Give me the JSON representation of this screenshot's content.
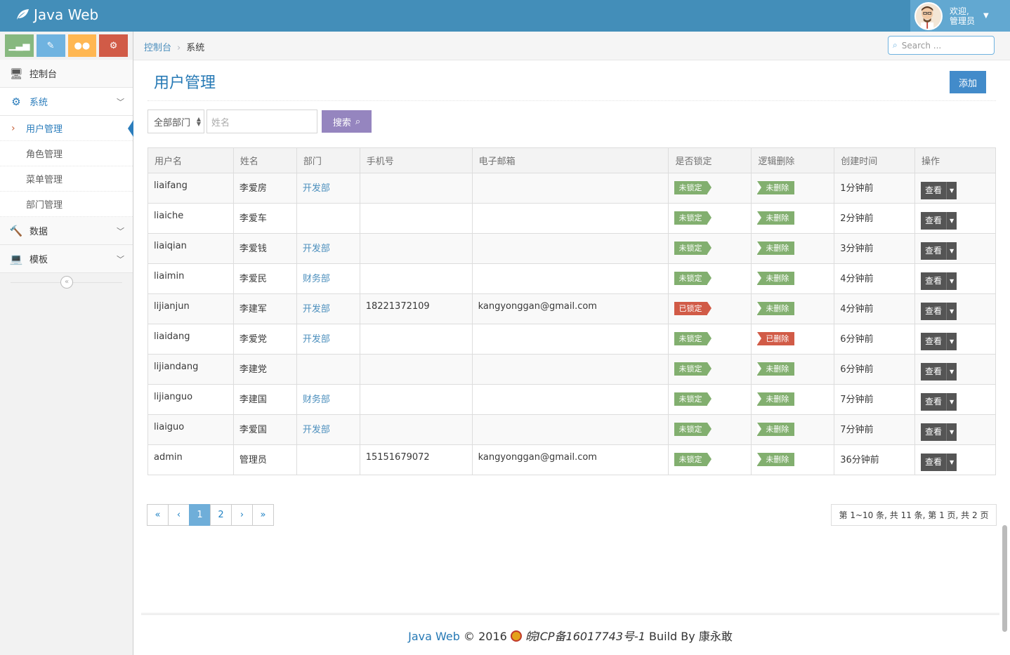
{
  "navbar": {
    "brand": "Java Web",
    "user_greeting": "欢迎,",
    "user_name": "管理员"
  },
  "shortcuts": [
    {
      "icon": "signal-icon",
      "color": "#87b87f"
    },
    {
      "icon": "pencil-icon",
      "color": "#6fb3e0"
    },
    {
      "icon": "users-icon",
      "color": "#ffb752"
    },
    {
      "icon": "cogs-icon",
      "color": "#d15b47"
    }
  ],
  "sidebar": {
    "dashboard": "控制台",
    "system": "系统",
    "system_items": [
      "用户管理",
      "角色管理",
      "菜单管理",
      "部门管理"
    ],
    "data": "数据",
    "template": "模板"
  },
  "breadcrumb": {
    "home": "控制台",
    "current": "系统"
  },
  "search": {
    "placeholder": "Search ..."
  },
  "page": {
    "title": "用户管理",
    "add_label": "添加"
  },
  "filter": {
    "dept_selected": "全部部门",
    "name_placeholder": "姓名",
    "search_label": "搜索"
  },
  "table": {
    "headers": [
      "用户名",
      "姓名",
      "部门",
      "手机号",
      "电子邮箱",
      "是否锁定",
      "逻辑删除",
      "创建时间",
      "操作"
    ],
    "rows": [
      {
        "username": "liaifang",
        "name": "李爱房",
        "dept": "开发部",
        "phone": "",
        "email": "",
        "locked": "未锁定",
        "deleted": "未删除",
        "created": "1分钟前"
      },
      {
        "username": "liaiche",
        "name": "李爱车",
        "dept": "",
        "phone": "",
        "email": "",
        "locked": "未锁定",
        "deleted": "未删除",
        "created": "2分钟前"
      },
      {
        "username": "liaiqian",
        "name": "李爱钱",
        "dept": "开发部",
        "phone": "",
        "email": "",
        "locked": "未锁定",
        "deleted": "未删除",
        "created": "3分钟前"
      },
      {
        "username": "liaimin",
        "name": "李爱民",
        "dept": "财务部",
        "phone": "",
        "email": "",
        "locked": "未锁定",
        "deleted": "未删除",
        "created": "4分钟前"
      },
      {
        "username": "lijianjun",
        "name": "李建军",
        "dept": "开发部",
        "phone": "18221372109",
        "email": "kangyonggan@gmail.com",
        "locked": "已锁定",
        "deleted": "未删除",
        "created": "4分钟前"
      },
      {
        "username": "liaidang",
        "name": "李爱党",
        "dept": "开发部",
        "phone": "",
        "email": "",
        "locked": "未锁定",
        "deleted": "已删除",
        "created": "6分钟前"
      },
      {
        "username": "lijiandang",
        "name": "李建党",
        "dept": "",
        "phone": "",
        "email": "",
        "locked": "未锁定",
        "deleted": "未删除",
        "created": "6分钟前"
      },
      {
        "username": "lijianguo",
        "name": "李建国",
        "dept": "财务部",
        "phone": "",
        "email": "",
        "locked": "未锁定",
        "deleted": "未删除",
        "created": "7分钟前"
      },
      {
        "username": "liaiguo",
        "name": "李爱国",
        "dept": "开发部",
        "phone": "",
        "email": "",
        "locked": "未锁定",
        "deleted": "未删除",
        "created": "7分钟前"
      },
      {
        "username": "admin",
        "name": "管理员",
        "dept": "",
        "phone": "15151679072",
        "email": "kangyonggan@gmail.com",
        "locked": "未锁定",
        "deleted": "未删除",
        "created": "36分钟前"
      }
    ],
    "action_label": "查看"
  },
  "pagination": {
    "first": "«",
    "prev": "‹",
    "pages": [
      "1",
      "2"
    ],
    "current": "1",
    "next": "›",
    "last": "»",
    "info": "第 1~10 条, 共 11 条, 第 1 页, 共 2 页"
  },
  "footer": {
    "brand": "Java Web",
    "copyright": "© 2016",
    "icp": "皖ICP备16017743号-1",
    "build": "Build By 康永敢"
  },
  "colors": {
    "navbar": "#438eb9",
    "ok": "#82af6f",
    "danger": "#d15b47",
    "primary": "#428bca",
    "search_button": "#9585bf"
  }
}
